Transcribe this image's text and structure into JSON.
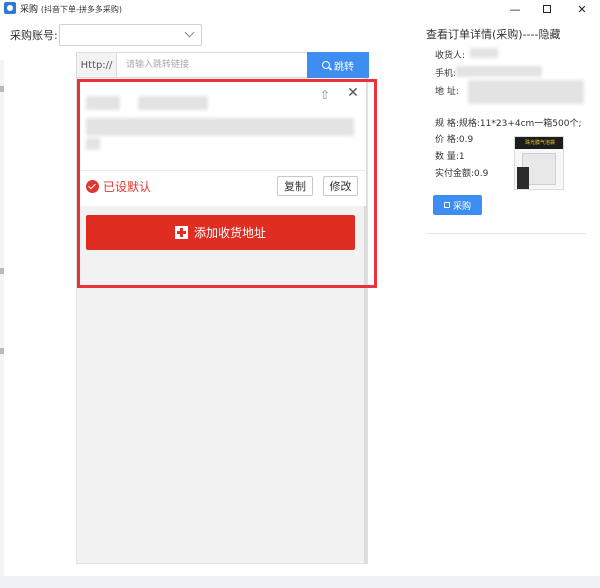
{
  "window": {
    "title": "采购",
    "subtitle": "(抖音下单-拼多多采购)",
    "minimize_glyph": "—",
    "close_glyph": "✕"
  },
  "account": {
    "label": "采购账号:",
    "selected_value": ""
  },
  "url_bar": {
    "prefix": "Http://",
    "placeholder": "请输入跳转链接",
    "value": "",
    "jump_label": "跳转",
    "icon": "search-icon"
  },
  "address_card": {
    "pin_glyph": "⇧",
    "close_glyph": "✕",
    "default_label": "已设默认",
    "copy_label": "复制",
    "edit_label": "修改",
    "accent_color": "#e03530"
  },
  "add_address": {
    "label": "添加收货地址",
    "icon": "plus-icon",
    "color": "#df2d22"
  },
  "order_detail": {
    "title": "查看订单详情(采购)----隐藏",
    "receiver_label": "收货人:",
    "phone_label": "手机:",
    "address_label": "地 址:",
    "spec_text": "规 格:规格:11*23+4cm一箱500个;",
    "price_text": "价 格:0.9",
    "quantity_text": "数 量:1",
    "paid_text": "实付金额:0.9",
    "product_image_text": "珠光膜气泡袋",
    "purchase_label": "采购",
    "accent_color": "#3d8ef0"
  }
}
